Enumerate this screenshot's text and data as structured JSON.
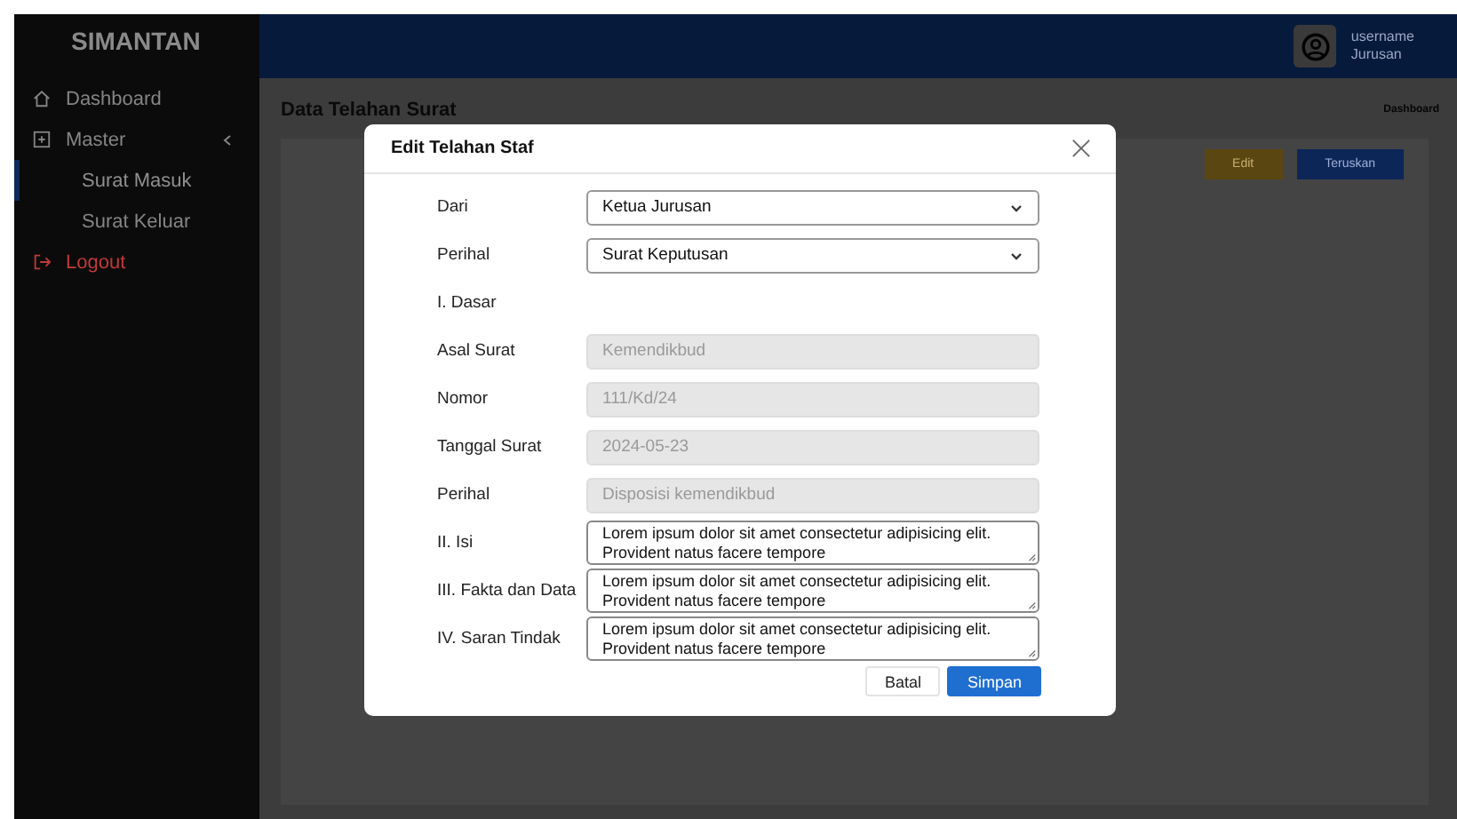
{
  "sidebar": {
    "brand": "SIMANTAN",
    "items": [
      {
        "label": "Dashboard",
        "kind": "home",
        "selected": false
      },
      {
        "label": "Master",
        "kind": "group",
        "selected": false
      },
      {
        "label": "Surat Masuk",
        "kind": "sub",
        "selected": true
      },
      {
        "label": "Surat Keluar",
        "kind": "sub",
        "selected": false
      },
      {
        "label": "Logout",
        "kind": "logout",
        "selected": false
      }
    ]
  },
  "header": {
    "username": "username",
    "role": "Jurusan"
  },
  "page": {
    "title": "Data Telahan Surat",
    "breadcrumb": "Dashboard",
    "actions": [
      {
        "label": "Edit",
        "kind": "warning"
      },
      {
        "label": "Teruskan",
        "kind": "primary"
      }
    ]
  },
  "modal": {
    "title": "Edit Telahan Staf",
    "fields": [
      {
        "label": "Dari",
        "kind": "select",
        "value": "Ketua Jurusan"
      },
      {
        "label": "Perihal",
        "kind": "select",
        "value": "Surat Keputusan"
      },
      {
        "label": "I. Dasar",
        "kind": "heading"
      },
      {
        "label": "Asal Surat",
        "kind": "disabled",
        "value": "Kemendikbud"
      },
      {
        "label": "Nomor",
        "kind": "disabled",
        "value": "111/Kd/24"
      },
      {
        "label": "Tanggal Surat",
        "kind": "disabled",
        "value": "2024-05-23"
      },
      {
        "label": "Perihal",
        "kind": "disabled",
        "value": "Disposisi kemendikbud"
      },
      {
        "label": "II. Isi",
        "kind": "textarea",
        "value": "Lorem ipsum dolor sit amet consectetur adipisicing elit. Provident natus facere tempore"
      },
      {
        "label": "III. Fakta dan Data",
        "kind": "textarea",
        "value": "Lorem ipsum dolor sit amet consectetur adipisicing elit. Provident natus facere tempore"
      },
      {
        "label": "IV. Saran Tindak",
        "kind": "textarea",
        "value": "Lorem ipsum dolor sit amet consectetur adipisicing elit. Provident natus facere tempore"
      }
    ],
    "buttons": [
      {
        "label": "Batal",
        "kind": "secondary"
      },
      {
        "label": "Simpan",
        "kind": "primary"
      }
    ]
  }
}
